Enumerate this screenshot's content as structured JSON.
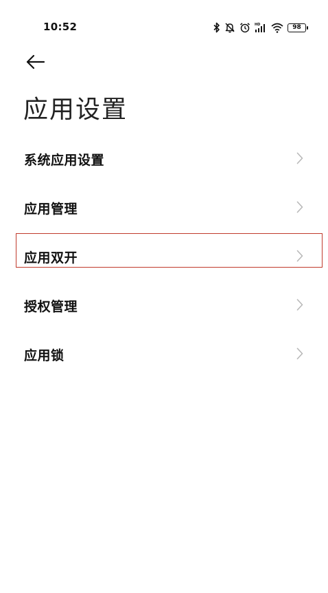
{
  "status_bar": {
    "time": "10:52",
    "battery_level": "98",
    "icons": [
      "bluetooth-icon",
      "mute-icon",
      "alarm-icon",
      "hd-signal-icon",
      "wifi-icon",
      "battery-icon"
    ]
  },
  "header": {
    "back_icon": "arrow-left-icon",
    "title": "应用设置"
  },
  "menu": {
    "items": [
      {
        "label": "系统应用设置",
        "icon": "chevron-right-icon"
      },
      {
        "label": "应用管理",
        "icon": "chevron-right-icon"
      },
      {
        "label": "应用双开",
        "icon": "chevron-right-icon"
      },
      {
        "label": "授权管理",
        "icon": "chevron-right-icon"
      },
      {
        "label": "应用锁",
        "icon": "chevron-right-icon"
      }
    ]
  },
  "colors": {
    "highlight_border": "#c0392b",
    "chevron": "#b8b8b8",
    "text": "#111111"
  }
}
